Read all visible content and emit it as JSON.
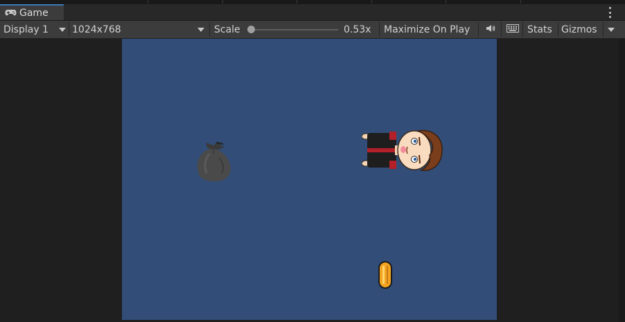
{
  "tab": {
    "title": "Game",
    "icon": "gamepad-icon"
  },
  "toolbar": {
    "display": "Display 1",
    "resolution": "1024x768",
    "scale_label": "Scale",
    "scale_value": "0.53x",
    "scale_fraction": 0.53,
    "maximize": "Maximize On Play",
    "audio_icon": "speaker-icon",
    "keyboard_icon": "keyboard-icon",
    "stats": "Stats",
    "gizmos": "Gizmos"
  },
  "scene": {
    "background_color": "#314d78",
    "objects": [
      "trash-bag-sprite",
      "player-boy-sprite",
      "coin-sprite"
    ]
  }
}
